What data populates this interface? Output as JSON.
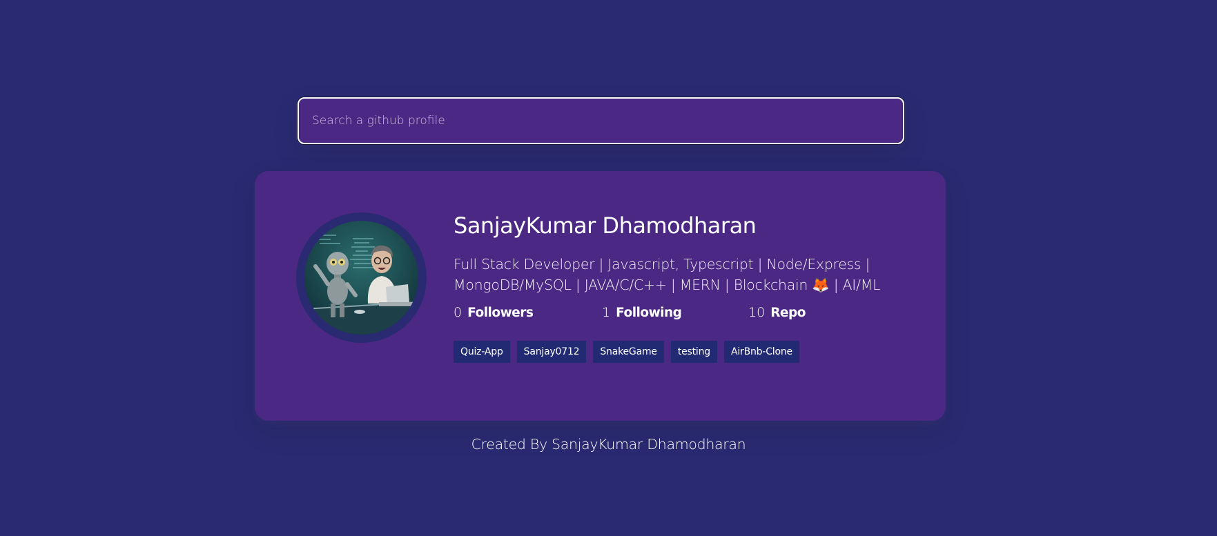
{
  "search": {
    "placeholder": "Search a github profile",
    "value": ""
  },
  "profile": {
    "name": "SanjayKumar Dhamodharan",
    "bio_line1": "Full Stack Developer | Javascript, Typescript | Node/Express |",
    "bio_line2": "MongoDB/MySQL | JAVA/C/C++ | MERN | Blockchain 🦊 | AI/ML",
    "stats": [
      {
        "count": "0",
        "label": "Followers"
      },
      {
        "count": "1",
        "label": "Following"
      },
      {
        "count": "10",
        "label": "Repo"
      }
    ],
    "repos": [
      "Quiz-App",
      "Sanjay0712",
      "SnakeGame",
      "testing",
      "AirBnb-Clone"
    ]
  },
  "footer": {
    "text": "Created By SanjayKumar Dhamodharan"
  },
  "colors": {
    "background": "#2a2a72",
    "card": "#4c2885",
    "repo_tag": "#212a72",
    "text": "#ffffff"
  },
  "icons": {
    "avatar": "user-avatar-image"
  }
}
